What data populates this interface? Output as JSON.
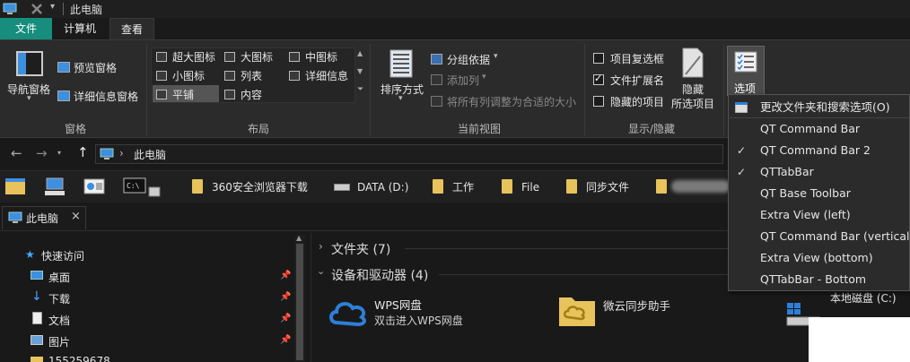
{
  "window": {
    "title": "此电脑"
  },
  "ribbon_tabs": {
    "file": "文件",
    "computer": "计算机",
    "view": "查看"
  },
  "ribbon": {
    "pane": {
      "nav_pane": "导航窗格",
      "preview_pane": "预览窗格",
      "details_pane": "详细信息窗格",
      "group": "窗格"
    },
    "layout": {
      "items": [
        "超大图标",
        "大图标",
        "中图标",
        "小图标",
        "列表",
        "详细信息",
        "平铺",
        "内容"
      ],
      "selected": "平铺",
      "group": "布局"
    },
    "current_view": {
      "sort_by": "排序方式",
      "group_by": "分组依据",
      "add_column": "添加列",
      "fit_columns": "将所有列调整为合适的大小",
      "group": "当前视图"
    },
    "show_hide": {
      "item_checkboxes": "项目复选框",
      "file_extensions": "文件扩展名",
      "hidden_items": "隐藏的项目",
      "hide_selected_line1": "隐藏",
      "hide_selected_line2": "所选项目",
      "group": "显示/隐藏",
      "checked": {
        "item_checkboxes": false,
        "file_extensions": true,
        "hidden_items": false
      }
    },
    "options": {
      "label": "选项"
    }
  },
  "address": {
    "path": "此电脑",
    "separator": "›"
  },
  "qt_bar": {
    "items": [
      "360安全浏览器下载",
      "DATA (D:)",
      "工作",
      "File",
      "同步文件"
    ]
  },
  "tab": {
    "label": "此电脑",
    "close": "×"
  },
  "nav": {
    "quick_access": "快速访问",
    "items": [
      "桌面",
      "下载",
      "文档",
      "图片",
      "155259678"
    ]
  },
  "content": {
    "folders_section": "文件夹 (7)",
    "devices_section": "设备和驱动器 (4)",
    "devices": [
      {
        "name": "WPS网盘",
        "desc": "双击进入WPS网盘"
      },
      {
        "name": "微云同步助手",
        "desc": ""
      },
      {
        "name": "本地磁盘 (C:)",
        "desc": ""
      }
    ]
  },
  "menu": {
    "items": [
      {
        "label": "更改文件夹和搜索选项(O)",
        "checked": false
      },
      {
        "label": "QT Command Bar",
        "checked": false
      },
      {
        "label": "QT Command Bar 2",
        "checked": true
      },
      {
        "label": "QTTabBar",
        "checked": true
      },
      {
        "label": "QT Base Toolbar",
        "checked": false
      },
      {
        "label": "Extra View (left)",
        "checked": false
      },
      {
        "label": "QT Command Bar (vertical)",
        "checked": false
      },
      {
        "label": "Extra View (bottom)",
        "checked": false
      },
      {
        "label": "QTTabBar - Bottom",
        "checked": false
      }
    ]
  },
  "colors": {
    "accent": "#168d7d",
    "folder": "#e8c25b",
    "wps_blue": "#2d7fd8"
  }
}
